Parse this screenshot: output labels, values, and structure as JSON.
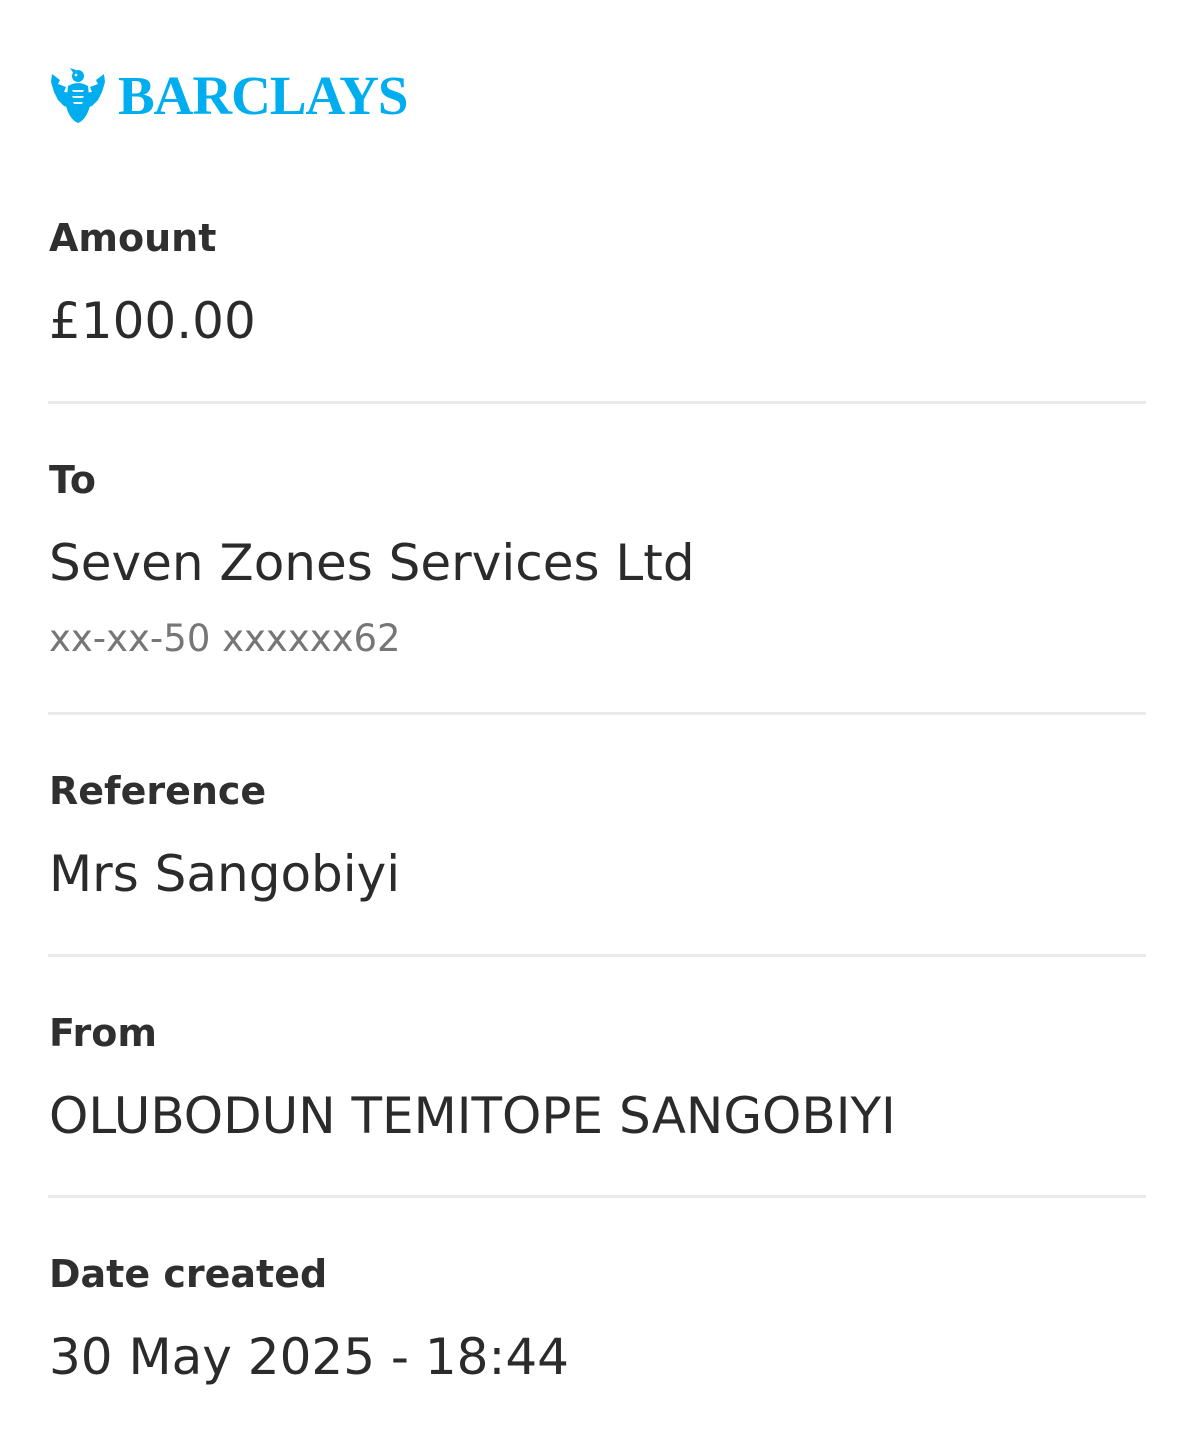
{
  "brand": {
    "name": "BARCLAYS",
    "color": "#00aeef",
    "icon": "eagle-icon"
  },
  "fields": {
    "amount": {
      "label": "Amount",
      "value": "£100.00"
    },
    "to": {
      "label": "To",
      "value": "Seven Zones Services Ltd",
      "account": "xx-xx-50 xxxxxx62"
    },
    "reference": {
      "label": "Reference",
      "value": "Mrs Sangobiyi"
    },
    "from": {
      "label": "From",
      "value": "OLUBODUN TEMITOPE SANGOBIYI"
    },
    "date_created": {
      "label": "Date created",
      "value": "30 May 2025 - 18:44"
    }
  }
}
